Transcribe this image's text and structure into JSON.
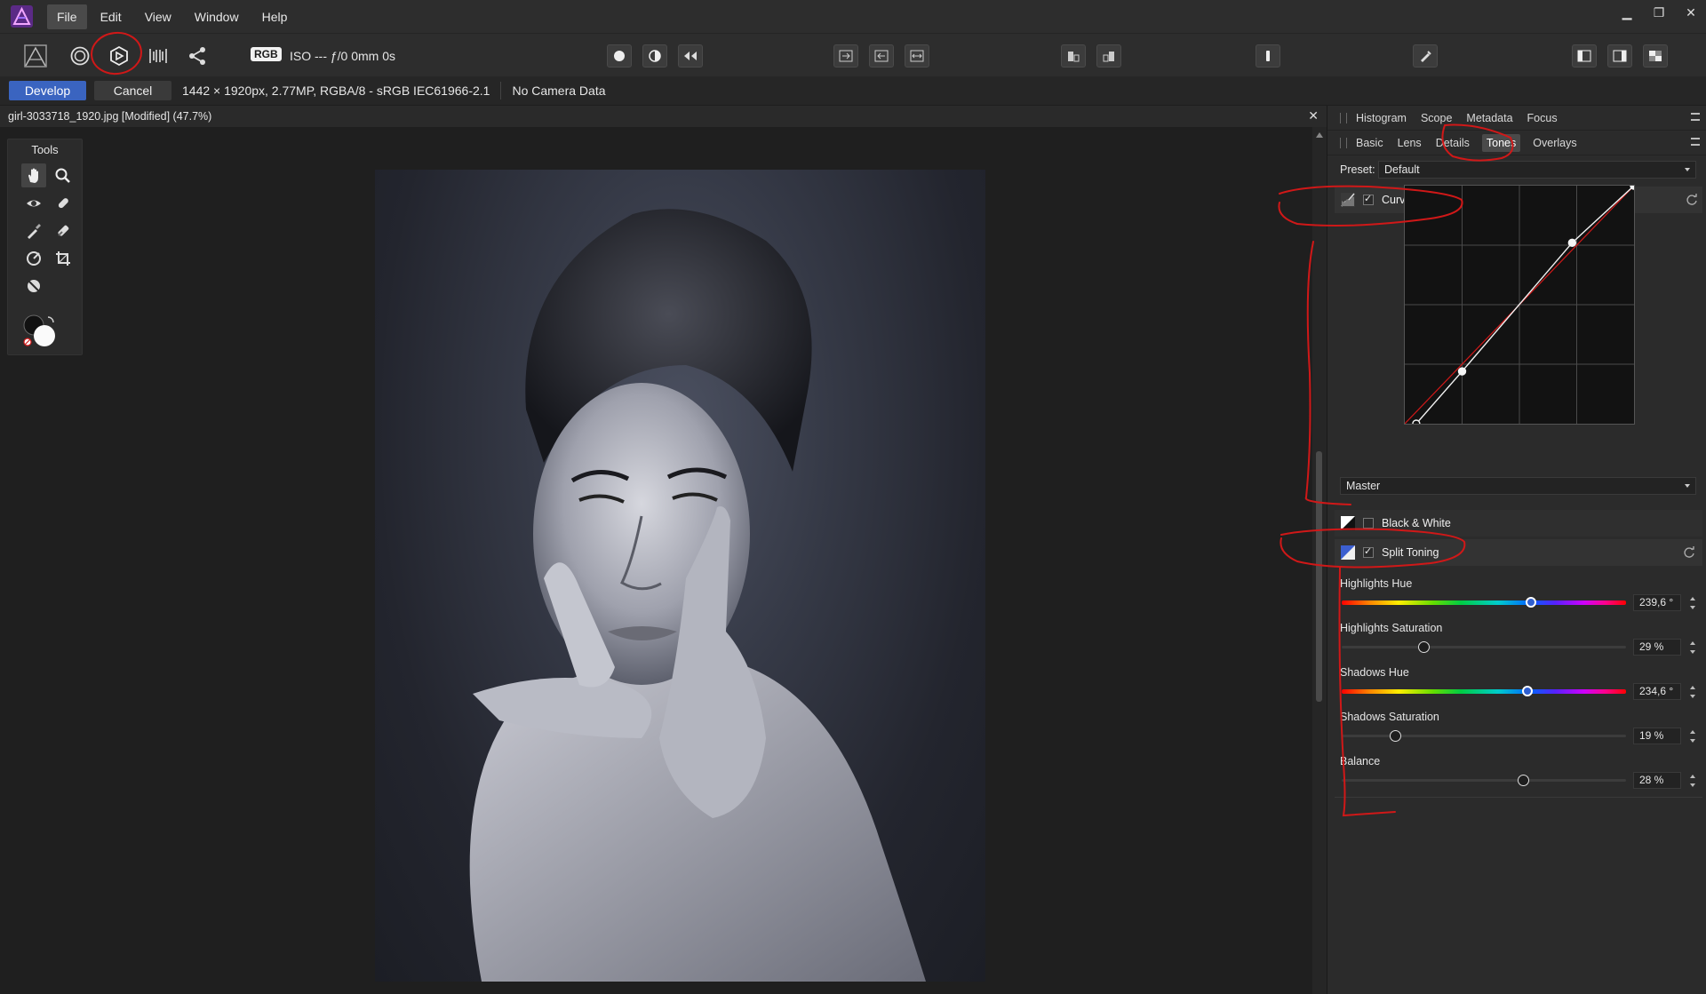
{
  "menubar": {
    "app_icon": "affinity-photo-logo-icon",
    "items": [
      {
        "label": "File",
        "active": true
      },
      {
        "label": "Edit"
      },
      {
        "label": "View"
      },
      {
        "label": "Window"
      },
      {
        "label": "Help"
      }
    ],
    "window_controls": [
      "minimize-icon",
      "restore-icon",
      "close-icon"
    ]
  },
  "toolbar": {
    "rgb_badge": "RGB",
    "exif": "ISO --- ƒ/0 0mm 0s"
  },
  "contextbar": {
    "develop_label": "Develop",
    "cancel_label": "Cancel",
    "image_info": "1442 × 1920px, 2.77MP, RGBA/8 - sRGB IEC61966-2.1",
    "camera_info": "No Camera Data"
  },
  "document": {
    "title": "girl-3033718_1920.jpg [Modified] (47.7%)",
    "close_glyph": "✕"
  },
  "tools": {
    "title": "Tools",
    "items": [
      "hand-tool-icon",
      "zoom-tool-icon",
      "red-eye-tool-icon",
      "blemish-removal-icon",
      "overlay-paint-icon",
      "overlay-erase-icon",
      "overlay-gradient-icon",
      "crop-tool-icon",
      "white-balance-picker-icon"
    ]
  },
  "panel_top_tabs": [
    "Histogram",
    "Scope",
    "Metadata",
    "Focus"
  ],
  "panel_tabs": [
    {
      "label": "Basic"
    },
    {
      "label": "Lens"
    },
    {
      "label": "Details"
    },
    {
      "label": "Tones",
      "active": true
    },
    {
      "label": "Overlays"
    }
  ],
  "preset": {
    "label": "Preset:",
    "value": "Default"
  },
  "curves": {
    "label": "Curves",
    "enabled": true,
    "channel": "Master",
    "points": [
      [
        0.05,
        0.0
      ],
      [
        0.25,
        0.22
      ],
      [
        0.73,
        0.76
      ],
      [
        1.0,
        1.0
      ]
    ]
  },
  "black_white": {
    "label": "Black & White",
    "enabled": false
  },
  "split_toning": {
    "label": "Split Toning",
    "enabled": true,
    "sliders": [
      {
        "label": "Highlights Hue",
        "value": "239,6 °",
        "type": "hue",
        "fraction": 0.666
      },
      {
        "label": "Highlights Saturation",
        "value": "29 %",
        "type": "plain",
        "fraction": 0.29
      },
      {
        "label": "Shadows Hue",
        "value": "234,6 °",
        "type": "hue",
        "fraction": 0.652
      },
      {
        "label": "Shadows Saturation",
        "value": "19 %",
        "type": "plain",
        "fraction": 0.19
      },
      {
        "label": "Balance",
        "value": "28 %",
        "type": "plain",
        "fraction": 0.64
      }
    ]
  },
  "colors": {
    "accent": "#3a64c0",
    "annotation": "#d01818",
    "panel_bg": "#2b2b2b"
  }
}
